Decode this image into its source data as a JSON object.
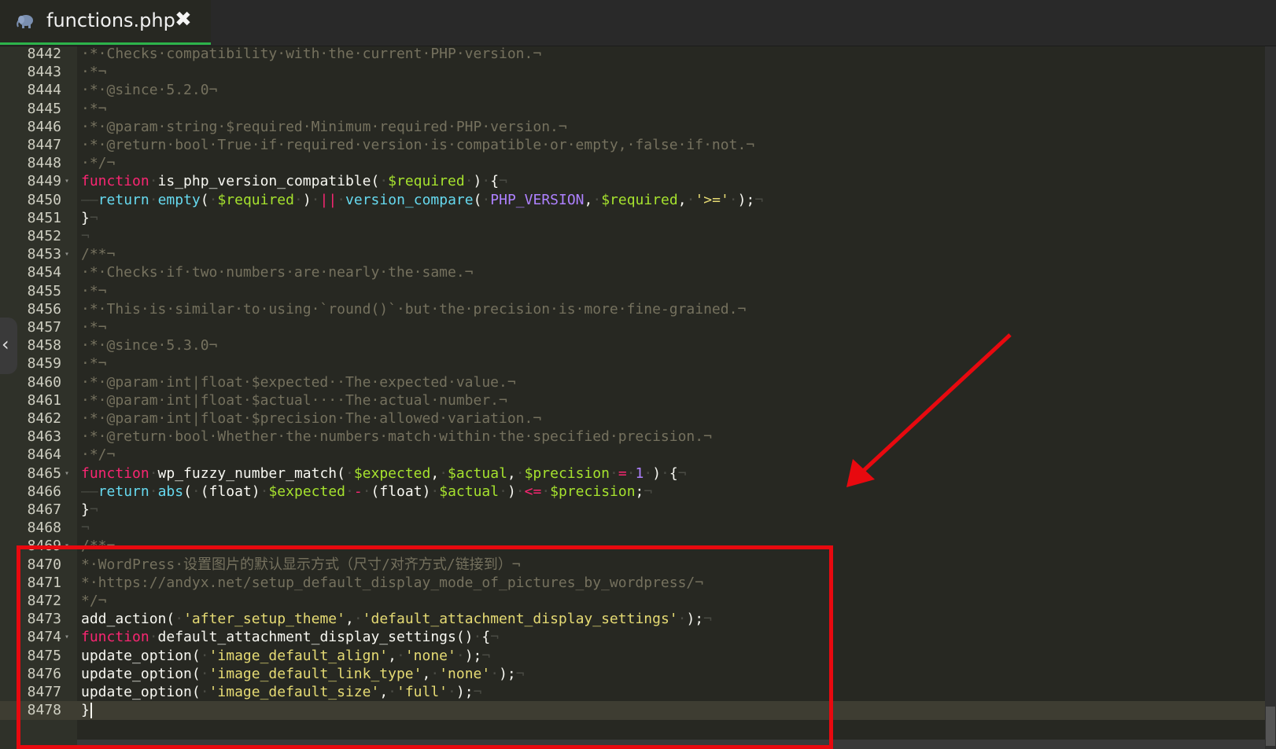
{
  "tab": {
    "title": "functions.php",
    "close_symbol": "✖",
    "icon": "php-elephant-icon"
  },
  "side_toggle": {
    "symbol": "‹",
    "icon": "chevron-left-icon"
  },
  "colors": {
    "background": "#272822",
    "gutter": "#2f3129",
    "comment": "#75715e",
    "keyword": "#f92672",
    "function": "#a6e22e",
    "builtin": "#66d9ef",
    "string": "#e6db74",
    "number": "#ae81ff",
    "annotation_red": "#e8090f",
    "tab_underline": "#2db34a"
  },
  "lines": [
    {
      "num": "8442",
      "fold": "",
      "tokens": [
        {
          "t": "·*·Checks·compatibility·with·the·current·PHP·version.¬",
          "c": "cm"
        }
      ]
    },
    {
      "num": "8443",
      "fold": "",
      "tokens": [
        {
          "t": "·*¬",
          "c": "cm"
        }
      ]
    },
    {
      "num": "8444",
      "fold": "",
      "tokens": [
        {
          "t": "·*·@since·5.2.0¬",
          "c": "cm"
        }
      ]
    },
    {
      "num": "8445",
      "fold": "",
      "tokens": [
        {
          "t": "·*¬",
          "c": "cm"
        }
      ]
    },
    {
      "num": "8446",
      "fold": "",
      "tokens": [
        {
          "t": "·*·@param·string·$required·Minimum·required·PHP·version.¬",
          "c": "cm"
        }
      ]
    },
    {
      "num": "8447",
      "fold": "",
      "tokens": [
        {
          "t": "·*·@return·bool·True·if·required·version·is·compatible·or·empty,·false·if·not.¬",
          "c": "cm"
        }
      ]
    },
    {
      "num": "8448",
      "fold": "",
      "tokens": [
        {
          "t": "·*/¬",
          "c": "cm"
        }
      ]
    },
    {
      "num": "8449",
      "fold": "▾",
      "tokens": [
        {
          "t": "function",
          "c": "kw"
        },
        {
          "t": "·",
          "c": "ws"
        },
        {
          "t": "is_php_version_compatible(",
          "c": "pl"
        },
        {
          "t": "·",
          "c": "ws"
        },
        {
          "t": "$required",
          "c": "var"
        },
        {
          "t": "·",
          "c": "ws"
        },
        {
          "t": ")",
          "c": "pl"
        },
        {
          "t": "·",
          "c": "ws"
        },
        {
          "t": "{",
          "c": "pl"
        },
        {
          "t": "¬",
          "c": "ws"
        }
      ]
    },
    {
      "num": "8450",
      "fold": "",
      "tokens": [
        {
          "t": "——",
          "c": "ws"
        },
        {
          "t": "return",
          "c": "bi"
        },
        {
          "t": "·",
          "c": "ws"
        },
        {
          "t": "empty",
          "c": "bi"
        },
        {
          "t": "(",
          "c": "pl"
        },
        {
          "t": "·",
          "c": "ws"
        },
        {
          "t": "$required",
          "c": "var"
        },
        {
          "t": "·",
          "c": "ws"
        },
        {
          "t": ")",
          "c": "pl"
        },
        {
          "t": "·",
          "c": "ws"
        },
        {
          "t": "||",
          "c": "op"
        },
        {
          "t": "·",
          "c": "ws"
        },
        {
          "t": "version_compare",
          "c": "bi"
        },
        {
          "t": "(",
          "c": "pl"
        },
        {
          "t": "·",
          "c": "ws"
        },
        {
          "t": "PHP_VERSION",
          "c": "cnst"
        },
        {
          "t": ",",
          "c": "pl"
        },
        {
          "t": "·",
          "c": "ws"
        },
        {
          "t": "$required",
          "c": "var"
        },
        {
          "t": ",",
          "c": "pl"
        },
        {
          "t": "·",
          "c": "ws"
        },
        {
          "t": "'>='",
          "c": "str"
        },
        {
          "t": "·",
          "c": "ws"
        },
        {
          "t": ");",
          "c": "pl"
        },
        {
          "t": "¬",
          "c": "ws"
        }
      ]
    },
    {
      "num": "8451",
      "fold": "",
      "tokens": [
        {
          "t": "}",
          "c": "pl"
        },
        {
          "t": "¬",
          "c": "ws"
        }
      ]
    },
    {
      "num": "8452",
      "fold": "",
      "tokens": [
        {
          "t": "¬",
          "c": "ws"
        }
      ]
    },
    {
      "num": "8453",
      "fold": "▾",
      "tokens": [
        {
          "t": "/**¬",
          "c": "cm"
        }
      ]
    },
    {
      "num": "8454",
      "fold": "",
      "tokens": [
        {
          "t": "·*·Checks·if·two·numbers·are·nearly·the·same.¬",
          "c": "cm"
        }
      ]
    },
    {
      "num": "8455",
      "fold": "",
      "tokens": [
        {
          "t": "·*¬",
          "c": "cm"
        }
      ]
    },
    {
      "num": "8456",
      "fold": "",
      "tokens": [
        {
          "t": "·*·This·is·similar·to·using·`round()`·but·the·precision·is·more·fine-grained.¬",
          "c": "cm"
        }
      ]
    },
    {
      "num": "8457",
      "fold": "",
      "tokens": [
        {
          "t": "·*¬",
          "c": "cm"
        }
      ]
    },
    {
      "num": "8458",
      "fold": "",
      "tokens": [
        {
          "t": "·*·@since·5.3.0¬",
          "c": "cm"
        }
      ]
    },
    {
      "num": "8459",
      "fold": "",
      "tokens": [
        {
          "t": "·*¬",
          "c": "cm"
        }
      ]
    },
    {
      "num": "8460",
      "fold": "",
      "tokens": [
        {
          "t": "·*·@param·int|float·$expected··The·expected·value.¬",
          "c": "cm"
        }
      ]
    },
    {
      "num": "8461",
      "fold": "",
      "tokens": [
        {
          "t": "·*·@param·int|float·$actual····The·actual·number.¬",
          "c": "cm"
        }
      ]
    },
    {
      "num": "8462",
      "fold": "",
      "tokens": [
        {
          "t": "·*·@param·int|float·$precision·The·allowed·variation.¬",
          "c": "cm"
        }
      ]
    },
    {
      "num": "8463",
      "fold": "",
      "tokens": [
        {
          "t": "·*·@return·bool·Whether·the·numbers·match·within·the·specified·precision.¬",
          "c": "cm"
        }
      ]
    },
    {
      "num": "8464",
      "fold": "",
      "tokens": [
        {
          "t": "·*/¬",
          "c": "cm"
        }
      ]
    },
    {
      "num": "8465",
      "fold": "▾",
      "tokens": [
        {
          "t": "function",
          "c": "kw"
        },
        {
          "t": "·",
          "c": "ws"
        },
        {
          "t": "wp_fuzzy_number_match(",
          "c": "pl"
        },
        {
          "t": "·",
          "c": "ws"
        },
        {
          "t": "$expected",
          "c": "var"
        },
        {
          "t": ",",
          "c": "pl"
        },
        {
          "t": "·",
          "c": "ws"
        },
        {
          "t": "$actual",
          "c": "var"
        },
        {
          "t": ",",
          "c": "pl"
        },
        {
          "t": "·",
          "c": "ws"
        },
        {
          "t": "$precision",
          "c": "var"
        },
        {
          "t": "·",
          "c": "ws"
        },
        {
          "t": "=",
          "c": "op"
        },
        {
          "t": "·",
          "c": "ws"
        },
        {
          "t": "1",
          "c": "num"
        },
        {
          "t": "·",
          "c": "ws"
        },
        {
          "t": ")",
          "c": "pl"
        },
        {
          "t": "·",
          "c": "ws"
        },
        {
          "t": "{",
          "c": "pl"
        },
        {
          "t": "¬",
          "c": "ws"
        }
      ]
    },
    {
      "num": "8466",
      "fold": "",
      "tokens": [
        {
          "t": "——",
          "c": "ws"
        },
        {
          "t": "return",
          "c": "bi"
        },
        {
          "t": "·",
          "c": "ws"
        },
        {
          "t": "abs",
          "c": "bi"
        },
        {
          "t": "(",
          "c": "pl"
        },
        {
          "t": "·",
          "c": "ws"
        },
        {
          "t": "(float)",
          "c": "pl"
        },
        {
          "t": "·",
          "c": "ws"
        },
        {
          "t": "$expected",
          "c": "var"
        },
        {
          "t": "·",
          "c": "ws"
        },
        {
          "t": "-",
          "c": "op"
        },
        {
          "t": "·",
          "c": "ws"
        },
        {
          "t": "(float)",
          "c": "pl"
        },
        {
          "t": "·",
          "c": "ws"
        },
        {
          "t": "$actual",
          "c": "var"
        },
        {
          "t": "·",
          "c": "ws"
        },
        {
          "t": ")",
          "c": "pl"
        },
        {
          "t": "·",
          "c": "ws"
        },
        {
          "t": "<=",
          "c": "op"
        },
        {
          "t": "·",
          "c": "ws"
        },
        {
          "t": "$precision",
          "c": "var"
        },
        {
          "t": ";",
          "c": "pl"
        },
        {
          "t": "¬",
          "c": "ws"
        }
      ]
    },
    {
      "num": "8467",
      "fold": "",
      "tokens": [
        {
          "t": "}",
          "c": "pl"
        },
        {
          "t": "¬",
          "c": "ws"
        }
      ]
    },
    {
      "num": "8468",
      "fold": "",
      "tokens": [
        {
          "t": "¬",
          "c": "ws"
        }
      ]
    },
    {
      "num": "8469",
      "fold": "▾",
      "tokens": [
        {
          "t": "/**¬",
          "c": "cm"
        }
      ]
    },
    {
      "num": "8470",
      "fold": "",
      "tokens": [
        {
          "t": "*·WordPress·设置图片的默认显示方式（尺寸/对齐方式/链接到）¬",
          "c": "cm"
        }
      ]
    },
    {
      "num": "8471",
      "fold": "",
      "tokens": [
        {
          "t": "*·https://andyx.net/setup_default_display_mode_of_pictures_by_wordpress/¬",
          "c": "cm"
        }
      ]
    },
    {
      "num": "8472",
      "fold": "",
      "tokens": [
        {
          "t": "*/¬",
          "c": "cm"
        }
      ]
    },
    {
      "num": "8473",
      "fold": "",
      "tokens": [
        {
          "t": "add_action(",
          "c": "pl"
        },
        {
          "t": "·",
          "c": "ws"
        },
        {
          "t": "'after_setup_theme'",
          "c": "str"
        },
        {
          "t": ",",
          "c": "pl"
        },
        {
          "t": "·",
          "c": "ws"
        },
        {
          "t": "'default_attachment_display_settings'",
          "c": "str"
        },
        {
          "t": "·",
          "c": "ws"
        },
        {
          "t": ");",
          "c": "pl"
        },
        {
          "t": "¬",
          "c": "ws"
        }
      ]
    },
    {
      "num": "8474",
      "fold": "▾",
      "tokens": [
        {
          "t": "function",
          "c": "kw"
        },
        {
          "t": "·",
          "c": "ws"
        },
        {
          "t": "default_attachment_display_settings()",
          "c": "pl"
        },
        {
          "t": "·",
          "c": "ws"
        },
        {
          "t": "{",
          "c": "pl"
        },
        {
          "t": "¬",
          "c": "ws"
        }
      ]
    },
    {
      "num": "8475",
      "fold": "",
      "tokens": [
        {
          "t": "update_option(",
          "c": "pl"
        },
        {
          "t": "·",
          "c": "ws"
        },
        {
          "t": "'image_default_align'",
          "c": "str"
        },
        {
          "t": ",",
          "c": "pl"
        },
        {
          "t": "·",
          "c": "ws"
        },
        {
          "t": "'none'",
          "c": "str"
        },
        {
          "t": "·",
          "c": "ws"
        },
        {
          "t": ");",
          "c": "pl"
        },
        {
          "t": "¬",
          "c": "ws"
        }
      ]
    },
    {
      "num": "8476",
      "fold": "",
      "tokens": [
        {
          "t": "update_option(",
          "c": "pl"
        },
        {
          "t": "·",
          "c": "ws"
        },
        {
          "t": "'image_default_link_type'",
          "c": "str"
        },
        {
          "t": ",",
          "c": "pl"
        },
        {
          "t": "·",
          "c": "ws"
        },
        {
          "t": "'none'",
          "c": "str"
        },
        {
          "t": "·",
          "c": "ws"
        },
        {
          "t": ");",
          "c": "pl"
        },
        {
          "t": "¬",
          "c": "ws"
        }
      ]
    },
    {
      "num": "8477",
      "fold": "",
      "tokens": [
        {
          "t": "update_option(",
          "c": "pl"
        },
        {
          "t": "·",
          "c": "ws"
        },
        {
          "t": "'image_default_size'",
          "c": "str"
        },
        {
          "t": ",",
          "c": "pl"
        },
        {
          "t": "·",
          "c": "ws"
        },
        {
          "t": "'full'",
          "c": "str"
        },
        {
          "t": "·",
          "c": "ws"
        },
        {
          "t": ");",
          "c": "pl"
        },
        {
          "t": "¬",
          "c": "ws"
        }
      ]
    },
    {
      "num": "8478",
      "fold": "",
      "active": true,
      "cursor": true,
      "tokens": [
        {
          "t": "}",
          "c": "pl"
        }
      ]
    }
  ]
}
